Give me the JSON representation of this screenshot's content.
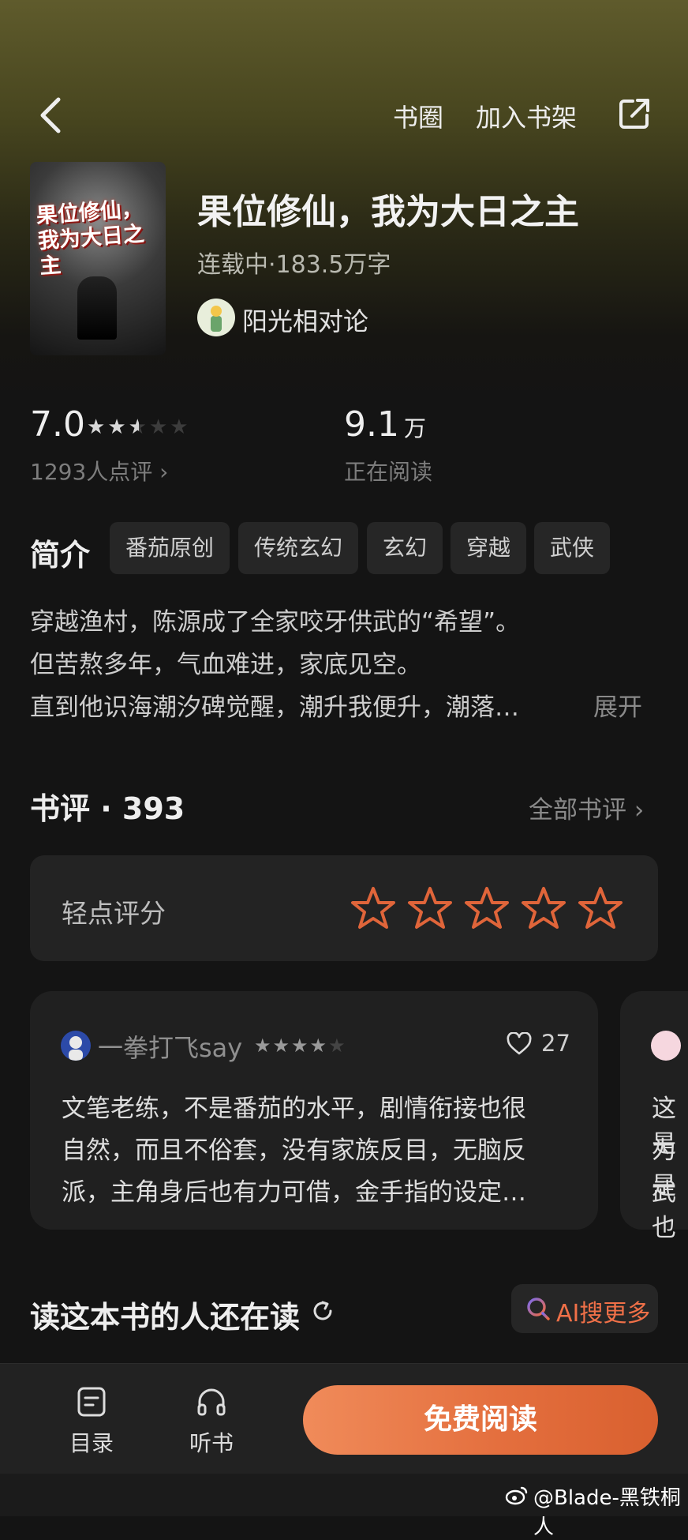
{
  "nav": {
    "circle_label": "书圈",
    "add_shelf_label": "加入书架"
  },
  "book": {
    "title": "果位修仙，我为大日之主",
    "meta": "连载中·183.5万字",
    "author": "阳光相对论",
    "cover_title": "果位修仙，我为大日之主"
  },
  "rating": {
    "score": "7.0",
    "star_fill": 2.5,
    "stars_total": 5,
    "reviewers": "1293人点评",
    "readers_value": "9.1",
    "readers_unit": "万",
    "readers_label": "正在阅读"
  },
  "intro": {
    "label": "简介",
    "tags": [
      "番茄原创",
      "传统玄幻",
      "玄幻",
      "穿越",
      "武侠"
    ],
    "lines": [
      "穿越渔村，陈源成了全家咬牙供武的“希望”。",
      "但苦熬多年，气血难进，家底见空。",
      "直到他识海潮汐碑觉醒，潮升我便升，潮落…"
    ],
    "expand_label": "展开"
  },
  "reviews": {
    "heading": "书评 · 393",
    "all_label": "全部书评",
    "rate_prompt": "轻点评分",
    "items": [
      {
        "user": "一拳打飞say",
        "stars": 4,
        "likes": "27",
        "lines": [
          "文笔老练，不是番茄的水平，剧情衔接也很",
          "自然，而且不俗套，没有家族反目，无脑反",
          "派，主角身后也有力可借，金手指的设定…"
        ]
      }
    ],
    "peek_lines": [
      "这是",
      "为是",
      "武也"
    ]
  },
  "also_reading": {
    "title": "读这本书的人还在读",
    "ai_label": "AI搜更多"
  },
  "bottom": {
    "toc_label": "目录",
    "listen_label": "听书",
    "read_label": "免费阅读"
  },
  "watermark": "@Blade-黑铁桐人",
  "colors": {
    "accent": "#e8723f",
    "star_outline": "#e0653a",
    "background": "#141414"
  }
}
